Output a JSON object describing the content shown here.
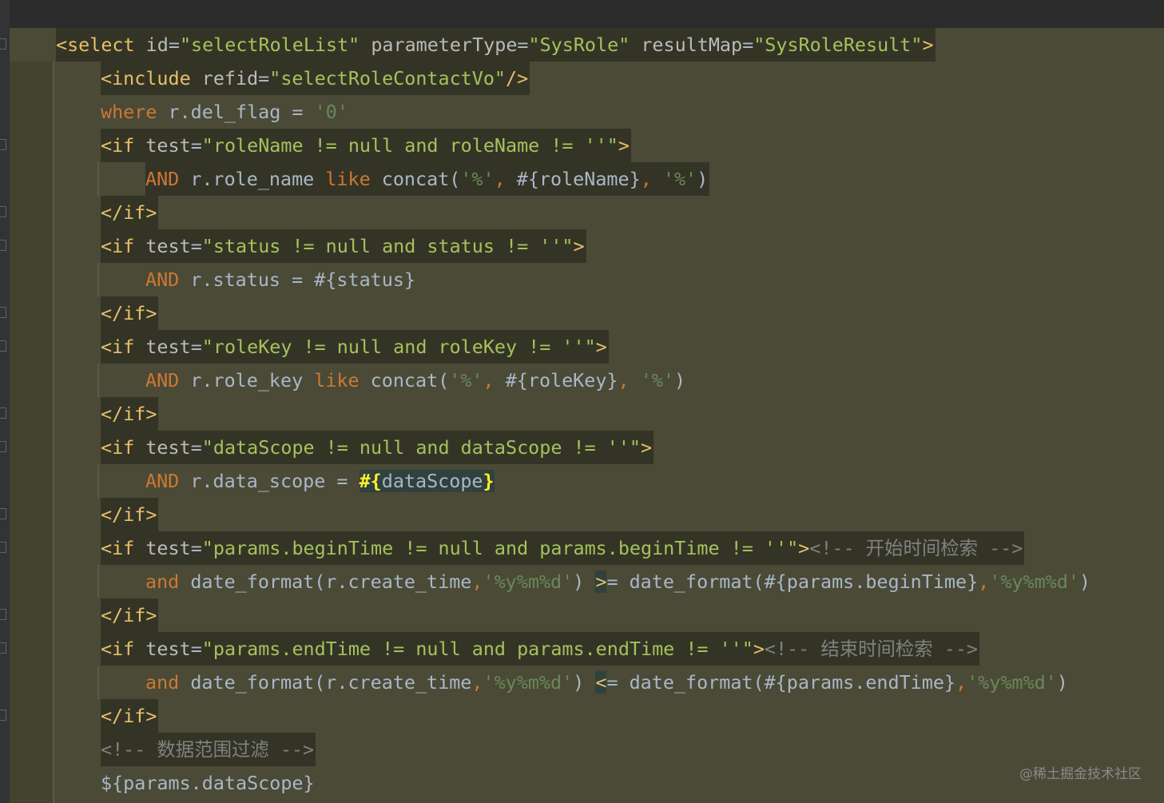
{
  "editor": {
    "lines": [
      [
        [
          "t",
          "<select "
        ],
        [
          "a",
          "id"
        ],
        [
          "p",
          "="
        ],
        [
          "v",
          "\"selectRoleList\""
        ],
        [
          "a",
          " parameterType"
        ],
        [
          "p",
          "="
        ],
        [
          "v",
          "\"SysRole\""
        ],
        [
          "a",
          " resultMap"
        ],
        [
          "p",
          "="
        ],
        [
          "v",
          "\"SysRoleResult\""
        ],
        [
          "t",
          ">"
        ]
      ],
      [
        [
          "t",
          "<include "
        ],
        [
          "a",
          "refid"
        ],
        [
          "p",
          "="
        ],
        [
          "v",
          "\"selectRoleContactVo\""
        ],
        [
          "t",
          "/>"
        ]
      ],
      [
        [
          "k",
          "where"
        ],
        [
          "p",
          " r.del_flag = "
        ],
        [
          "s",
          "'0'"
        ]
      ],
      [
        [
          "t",
          "<if "
        ],
        [
          "a",
          "test"
        ],
        [
          "p",
          "="
        ],
        [
          "v",
          "\"roleName != null and roleName != ''\""
        ],
        [
          "t",
          ">"
        ]
      ],
      [
        [
          "k",
          "AND"
        ],
        [
          "p",
          " r.role_name "
        ],
        [
          "k",
          "like"
        ],
        [
          "p",
          " concat("
        ],
        [
          "s",
          "'%'"
        ],
        [
          "k",
          ","
        ],
        [
          "p",
          " #{roleName}"
        ],
        [
          "k",
          ","
        ],
        [
          "p",
          " "
        ],
        [
          "s",
          "'%'"
        ],
        [
          "p",
          ")"
        ]
      ],
      [
        [
          "t",
          "</if>"
        ]
      ],
      [
        [
          "t",
          "<if "
        ],
        [
          "a",
          "test"
        ],
        [
          "p",
          "="
        ],
        [
          "v",
          "\"status != null and status != ''\""
        ],
        [
          "t",
          ">"
        ]
      ],
      [
        [
          "k",
          "AND"
        ],
        [
          "p",
          " r.status = #{status}"
        ]
      ],
      [
        [
          "t",
          "</if>"
        ]
      ],
      [
        [
          "t",
          "<if "
        ],
        [
          "a",
          "test"
        ],
        [
          "p",
          "="
        ],
        [
          "v",
          "\"roleKey != null and roleKey != ''\""
        ],
        [
          "t",
          ">"
        ]
      ],
      [
        [
          "k",
          "AND"
        ],
        [
          "p",
          " r.role_key "
        ],
        [
          "k",
          "like"
        ],
        [
          "p",
          " concat("
        ],
        [
          "s",
          "'%'"
        ],
        [
          "k",
          ","
        ],
        [
          "p",
          " #{roleKey}"
        ],
        [
          "k",
          ","
        ],
        [
          "p",
          " "
        ],
        [
          "s",
          "'%'"
        ],
        [
          "p",
          ")"
        ]
      ],
      [
        [
          "t",
          "</if>"
        ]
      ],
      [
        [
          "t",
          "<if "
        ],
        [
          "a",
          "test"
        ],
        [
          "p",
          "="
        ],
        [
          "v",
          "\"dataScope != null and dataScope != ''\""
        ],
        [
          "t",
          ">"
        ]
      ],
      [
        [
          "k",
          "AND"
        ],
        [
          "p",
          " r.data_scope = "
        ],
        [
          "y",
          "#{"
        ],
        [
          "p",
          "dataScope"
        ],
        [
          "y",
          "}"
        ]
      ],
      [
        [
          "t",
          "</if>"
        ]
      ],
      [
        [
          "t",
          "<if "
        ],
        [
          "a",
          "test"
        ],
        [
          "p",
          "="
        ],
        [
          "v",
          "\"params.beginTime != null and params.beginTime != ''\""
        ],
        [
          "t",
          ">"
        ],
        [
          "c",
          "<!-- 开始时间检索 -->"
        ]
      ],
      [
        [
          "k",
          "and"
        ],
        [
          "p",
          " date_format(r.create_time"
        ],
        [
          "k",
          ","
        ],
        [
          "s",
          "'%y%m%d'"
        ],
        [
          "p",
          ") "
        ],
        [
          "t",
          ">"
        ],
        [
          "p",
          "= date_format(#{params.beginTime}"
        ],
        [
          "k",
          ","
        ],
        [
          "s",
          "'%y%m%d'"
        ],
        [
          "p",
          ")"
        ]
      ],
      [
        [
          "t",
          "</if>"
        ]
      ],
      [
        [
          "t",
          "<if "
        ],
        [
          "a",
          "test"
        ],
        [
          "p",
          "="
        ],
        [
          "v",
          "\"params.endTime != null and params.endTime != ''\""
        ],
        [
          "t",
          ">"
        ],
        [
          "c",
          "<!-- 结束时间检索 -->"
        ]
      ],
      [
        [
          "k",
          "and"
        ],
        [
          "p",
          " date_format(r.create_time"
        ],
        [
          "k",
          ","
        ],
        [
          "s",
          "'%y%m%d'"
        ],
        [
          "p",
          ") "
        ],
        [
          "t",
          "<"
        ],
        [
          "p",
          "= date_format(#{params.endTime}"
        ],
        [
          "k",
          ","
        ],
        [
          "s",
          "'%y%m%d'"
        ],
        [
          "p",
          ")"
        ]
      ],
      [
        [
          "t",
          "</if>"
        ]
      ],
      [
        [
          "c",
          "<!-- 数据范围过滤 -->"
        ]
      ],
      [
        [
          "p",
          "${params.dataScope}"
        ]
      ]
    ]
  },
  "watermark": "@稀土掘金技术社区"
}
